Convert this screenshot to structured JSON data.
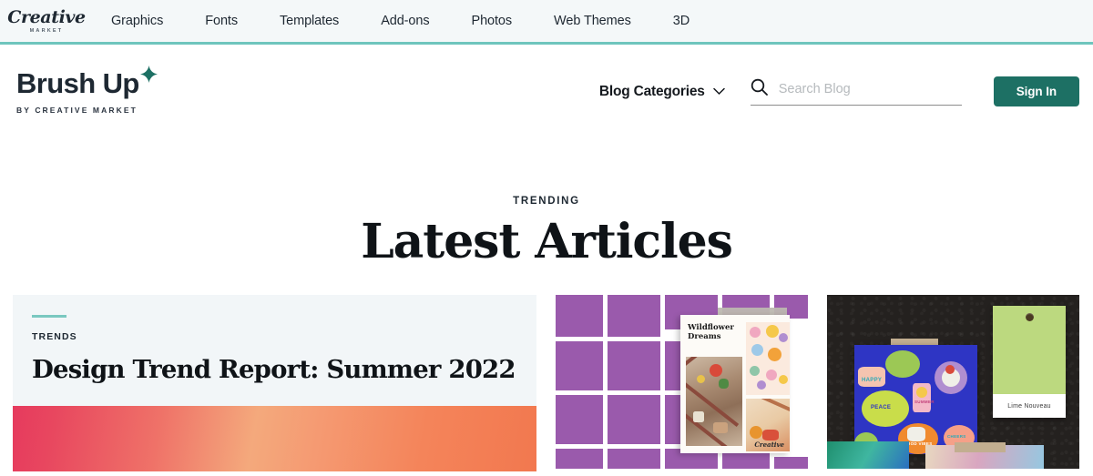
{
  "topnav": {
    "logo": {
      "script": "Creative",
      "sub": "MARKET",
      "icon": "creative-market-logo"
    },
    "items": [
      {
        "label": "Graphics"
      },
      {
        "label": "Fonts"
      },
      {
        "label": "Templates"
      },
      {
        "label": "Add-ons"
      },
      {
        "label": "Photos"
      },
      {
        "label": "Web Themes"
      },
      {
        "label": "3D"
      }
    ],
    "border_color": "#6ec5bd",
    "background": "#f4f8f9"
  },
  "header": {
    "brand_name": "Brush Up",
    "brand_sub": "BY CREATIVE MARKET",
    "star_icon": "sparkle-icon",
    "star_color": "#1d7064",
    "blog_categories_label": "Blog Categories",
    "chevron_icon": "chevron-down-icon",
    "search": {
      "icon": "search-icon",
      "placeholder": "Search Blog",
      "value": ""
    },
    "signin_label": "Sign In",
    "signin_color": "#1d7064"
  },
  "trending": {
    "eyebrow": "TRENDING",
    "title": "Latest Articles"
  },
  "cards": [
    {
      "kicker": "TRENDS",
      "title": "Design Trend Report: Summer 2022",
      "accent_color": "#7ac8c0",
      "background": "#f2f6f8",
      "image": "summer-gradient-banner"
    },
    {
      "image": "purple-tile-wall-wildflower-poster",
      "poster_title": "Wildflower Dreams",
      "poster_brand": "Creative"
    },
    {
      "image": "sticker-board-paint-swatch",
      "swatch_label": "Lime Nouveau",
      "swatch_color": "#bcd97f",
      "sticker_words": [
        "PEACE",
        "HAPPY",
        "SUMMER",
        "GOOD VIBES",
        "CHEERS"
      ]
    }
  ]
}
